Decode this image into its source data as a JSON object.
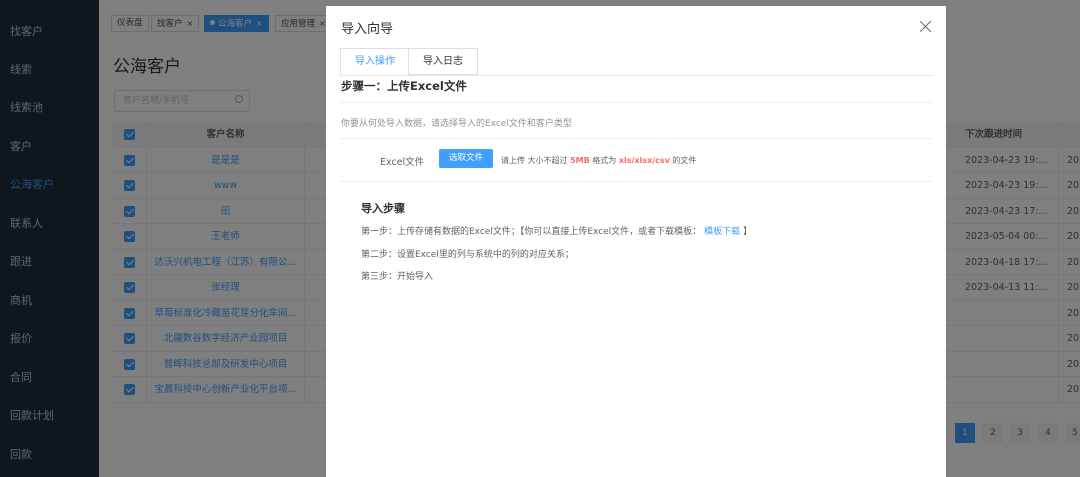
{
  "sidebar": {
    "items": [
      {
        "label": "找客户"
      },
      {
        "label": "线索"
      },
      {
        "label": "线索池"
      },
      {
        "label": "客户"
      },
      {
        "label": "公海客户"
      },
      {
        "label": "联系人"
      },
      {
        "label": "跟进"
      },
      {
        "label": "商机"
      },
      {
        "label": "报价"
      },
      {
        "label": "合同"
      },
      {
        "label": "回款计划"
      },
      {
        "label": "回款"
      }
    ]
  },
  "tags": [
    {
      "label": "仪表盘"
    },
    {
      "label": "找客户"
    },
    {
      "label": "公海客户"
    },
    {
      "label": "应用管理"
    }
  ],
  "page": {
    "title": "公海客户",
    "search_placeholder": "客户名称/手机号"
  },
  "table": {
    "headers": {
      "name": "客户名称",
      "next_followup": "下次跟进时间"
    },
    "rows": [
      {
        "name": "是是是",
        "next_followup": "2023-04-23 19:...",
        "extra": "202"
      },
      {
        "name": "www",
        "next_followup": "2023-04-23 19:...",
        "extra": "202"
      },
      {
        "name": "田",
        "next_followup": "2023-04-23 17:...",
        "extra": "202"
      },
      {
        "name": "王老师",
        "next_followup": "2023-05-04 00:...",
        "extra": "202"
      },
      {
        "name": "达沃兴机电工程（江苏）有限公...",
        "next_followup": "2023-04-18 17:...",
        "extra": "202"
      },
      {
        "name": "张经理",
        "next_followup": "2023-04-13 11:...",
        "extra": "202"
      },
      {
        "name": "草莓标准化冷藏苗花芽分化车间...",
        "next_followup": "",
        "extra": "202"
      },
      {
        "name": "北疆数谷数字经济产业园项目",
        "next_followup": "",
        "extra": "202"
      },
      {
        "name": "普晖科技总部及研发中心项目",
        "next_followup": "",
        "extra": "202"
      },
      {
        "name": "宝晨科技中心创新产业化平台项...",
        "next_followup": "",
        "extra": "202"
      }
    ]
  },
  "pagination": {
    "pages": [
      "1",
      "2",
      "3",
      "4",
      "5"
    ],
    "current": "1"
  },
  "dialog": {
    "title": "导入向导",
    "tabs": [
      {
        "label": "导入操作"
      },
      {
        "label": "导入日志"
      }
    ],
    "step_title": "步骤一：上传Excel文件",
    "description": "你要从何处导入数据，请选择导入的Excel文件和客户类型",
    "excel_label": "Excel文件",
    "upload_button": "选取文件",
    "tip_prefix": "请上传 大小不超过",
    "tip_size": "5MB",
    "tip_middle": "格式为",
    "tip_formats": "xls/xlsx/csv",
    "tip_suffix": "的文件",
    "steps_title": "导入步骤",
    "step1_text": "第一步：上传存储有数据的Excel文件；【你可以直接上传Excel文件，或者下载模板：",
    "step1_link": "模板下载",
    "step1_end": "】",
    "step2_text": "第二步：设置Excel里的列与系统中的列的对应关系；",
    "step3_text": "第三步：开始导入"
  },
  "colors": {
    "accent": "#409eff",
    "sidebar_bg": "#1f2d3d",
    "danger": "#f56c6c"
  }
}
